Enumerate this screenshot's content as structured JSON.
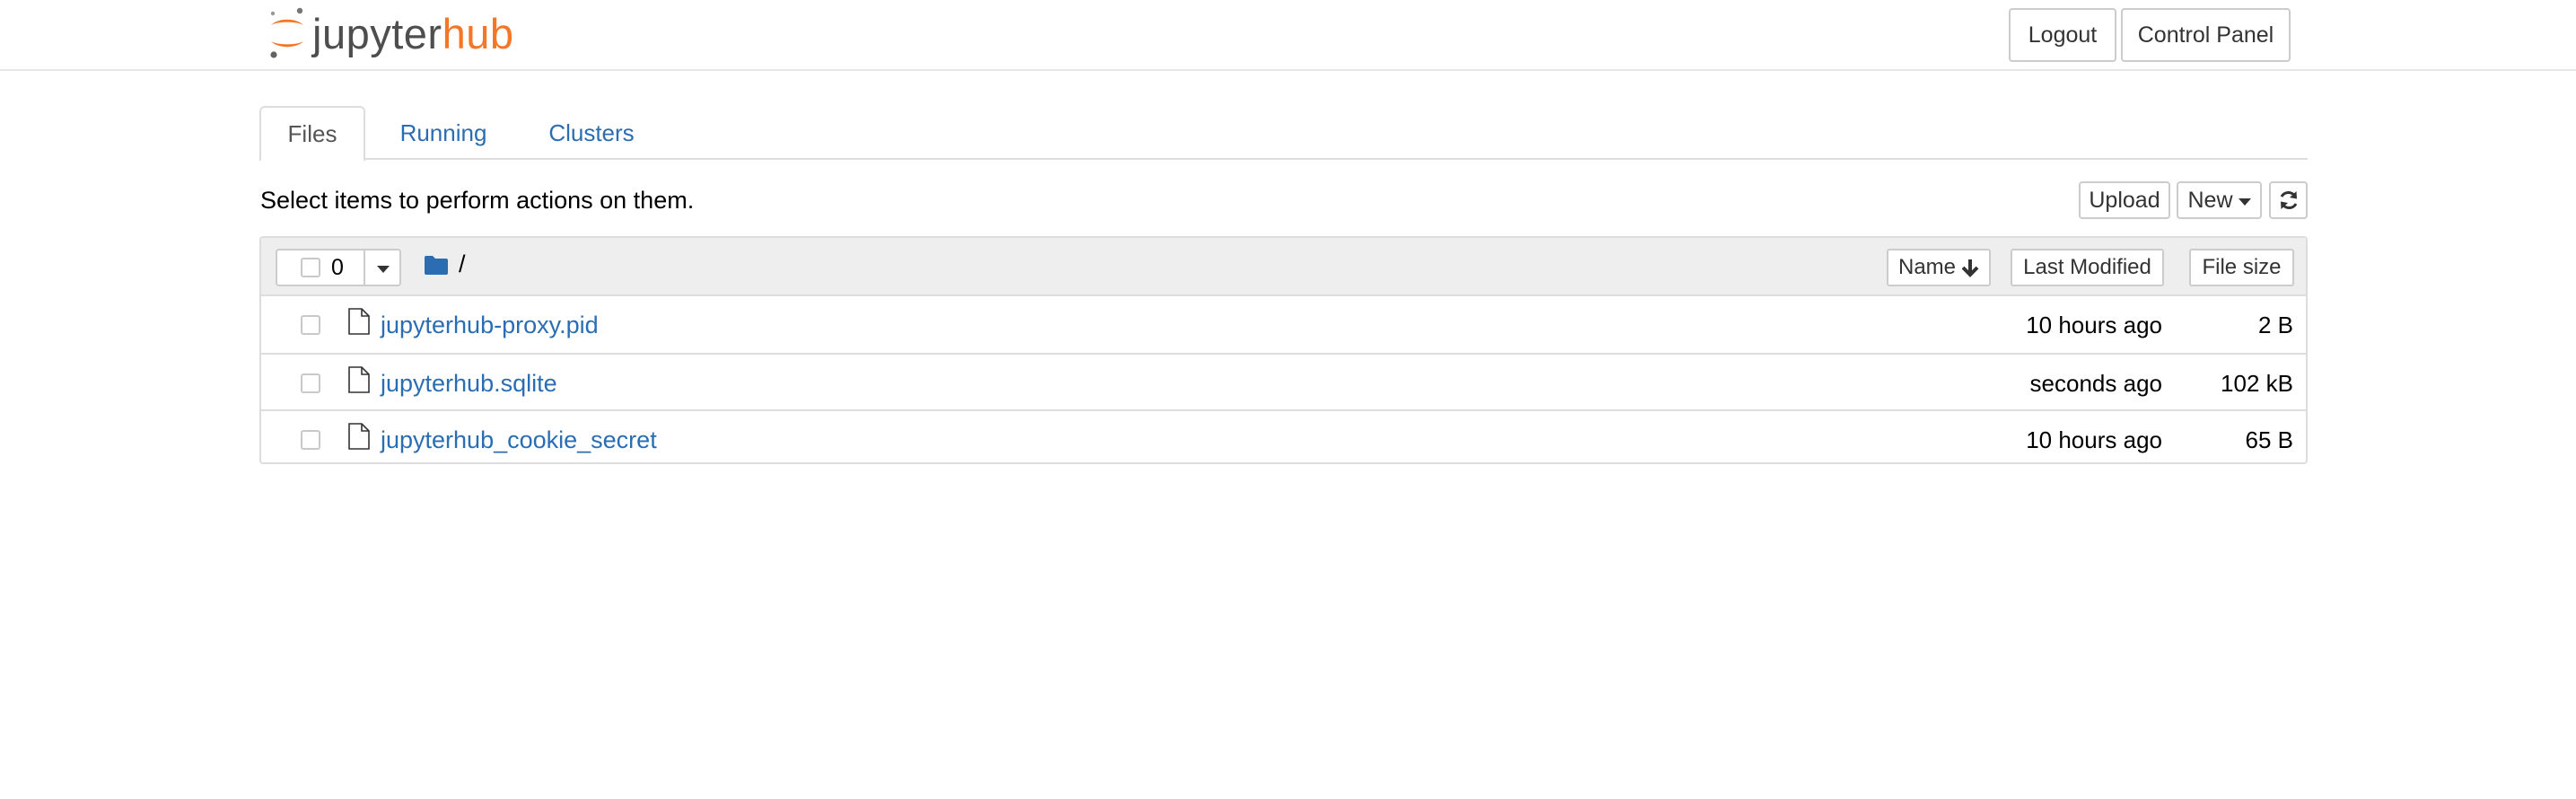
{
  "header": {
    "logo": {
      "part1": "jupyter",
      "part2": "hub",
      "icon": "jupyter-logo-icon"
    },
    "logout_label": "Logout",
    "control_panel_label": "Control Panel"
  },
  "tabs": [
    {
      "label": "Files",
      "active": true
    },
    {
      "label": "Running",
      "active": false
    },
    {
      "label": "Clusters",
      "active": false
    }
  ],
  "toolbar": {
    "hint": "Select items to perform actions on them.",
    "upload_label": "Upload",
    "new_label": "New",
    "refresh_icon": "refresh-icon"
  },
  "list": {
    "selected_count": "0",
    "breadcrumb_path": "/",
    "columns": {
      "name": "Name",
      "last_modified": "Last Modified",
      "file_size": "File size"
    },
    "files": [
      {
        "name": "jupyterhub-proxy.pid",
        "modified": "10 hours ago",
        "size": "2 B"
      },
      {
        "name": "jupyterhub.sqlite",
        "modified": "seconds ago",
        "size": "102 kB"
      },
      {
        "name": "jupyterhub_cookie_secret",
        "modified": "10 hours ago",
        "size": "65 B"
      }
    ]
  },
  "colors": {
    "brand_orange": "#f37726",
    "link_blue": "#2a6db2",
    "header_gray": "#eeeeee"
  }
}
